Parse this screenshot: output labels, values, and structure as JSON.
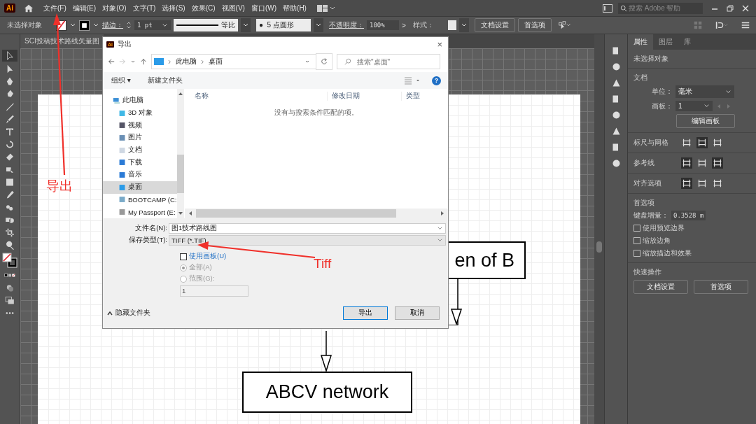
{
  "app": {
    "logo": "Ai",
    "menus": [
      "文件(F)",
      "编辑(E)",
      "对象(O)",
      "文字(T)",
      "选择(S)",
      "效果(C)",
      "视图(V)",
      "窗口(W)",
      "帮助(H)"
    ],
    "search": {
      "placeholder": "搜索 Adobe 帮助"
    }
  },
  "control_bar": {
    "selection": "未选择对象",
    "stroke_label": "描边：",
    "stroke_weight": "1 pt",
    "stroke_profile": "等比",
    "brush_bullet": "●",
    "brush": "5 点圆形",
    "opacity_label": "不透明度：",
    "opacity": "100%",
    "opacity_arrow": ">",
    "style_label": "样式：",
    "buttons": [
      "文档设置",
      "首选项"
    ]
  },
  "document_tab": {
    "title": "SCI投稿技术路线矢量图"
  },
  "artboard": {
    "flow_box_top": "en of B",
    "flow_box_bottom": "ABCV network"
  },
  "dialog": {
    "logo": "Ai",
    "title": "导出",
    "close": "×",
    "breadcrumb": [
      "此电脑",
      "桌面"
    ],
    "search": {
      "placeholder": "搜索\"桌面\""
    },
    "toolbar": {
      "organize": "组织 ▾",
      "new_folder": "新建文件夹",
      "help": "?"
    },
    "tree": [
      {
        "label": "此电脑",
        "selected": false,
        "children": [
          {
            "label": "3D 对象",
            "selected": false
          },
          {
            "label": "视频",
            "selected": false
          },
          {
            "label": "图片",
            "selected": false
          },
          {
            "label": "文档",
            "selected": false
          },
          {
            "label": "下载",
            "selected": false
          },
          {
            "label": "音乐",
            "selected": false
          },
          {
            "label": "桌面",
            "selected": true
          },
          {
            "label": "BOOTCAMP (C:",
            "selected": false
          },
          {
            "label": "My Passport (E:",
            "selected": false
          }
        ]
      }
    ],
    "columns": [
      "名称",
      "修改日期",
      "类型"
    ],
    "empty_message": "没有与搜索条件匹配的项。",
    "file_name": {
      "label": "文件名(N):",
      "value": "图1技术路线图"
    },
    "file_type": {
      "label": "保存类型(T):",
      "value": "TIFF (*.TIF)"
    },
    "use_artboards": {
      "label": "使用画板(U)",
      "checked": false
    },
    "ranges": [
      {
        "label": "全部(A)",
        "selected": true,
        "disabled": true
      },
      {
        "label": "范围(G):",
        "selected": false,
        "disabled": true
      }
    ],
    "range_input": {
      "value": "1",
      "disabled": true
    },
    "hide_folders": "隐藏文件夹",
    "buttons": [
      "导出",
      "取消"
    ]
  },
  "properties_panel": {
    "tabs": [
      {
        "label": "属性",
        "selected": true
      },
      {
        "label": "图层",
        "selected": false
      },
      {
        "label": "库",
        "selected": false
      }
    ],
    "selection": "未选择对象",
    "document_heading": "文档",
    "units_label": "单位：",
    "units": "毫米",
    "artboard_label": "画板：",
    "artboard": "1",
    "edit_artboards": "编辑画板",
    "icon_rows": [
      {
        "label": "标尺与网格",
        "buttons": [
          {
            "selected": false
          },
          {
            "selected": true
          },
          {
            "selected": false
          }
        ]
      },
      {
        "label": "参考线",
        "buttons": [
          {
            "selected": true
          },
          {
            "selected": false
          },
          {
            "selected": true
          }
        ]
      },
      {
        "label": "对齐选项",
        "buttons": [
          {
            "selected": true
          },
          {
            "selected": false
          },
          {
            "selected": false
          }
        ]
      }
    ],
    "preferences_heading": "首选项",
    "keyboard_label": "键盘增量：",
    "keyboard_value": "0.3528 m",
    "options": [
      {
        "label": "使用预览边界",
        "checked": false
      },
      {
        "label": "缩放边角",
        "checked": false
      },
      {
        "label": "缩放描边和效果",
        "checked": false
      }
    ],
    "quick_heading": "快速操作",
    "quick_buttons": [
      "文档设置",
      "首选项"
    ]
  },
  "annotations": [
    {
      "text": "导出"
    },
    {
      "text": "Tiff"
    }
  ]
}
